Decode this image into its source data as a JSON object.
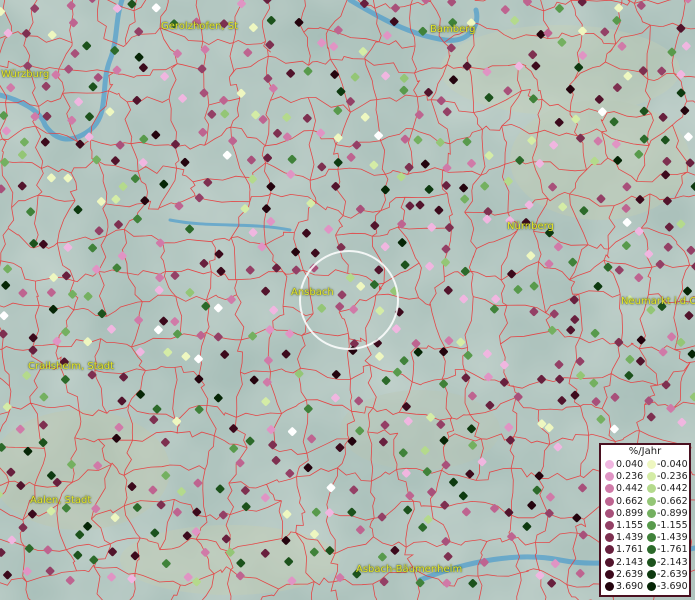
{
  "cities": [
    {
      "name": "Gerolzhofen, St",
      "key": "gerolzhofen"
    },
    {
      "name": "Bamberg",
      "key": "bamberg"
    },
    {
      "name": "Würzburg",
      "key": "wuerzburg"
    },
    {
      "name": "Nürnberg",
      "key": "nuernberg"
    },
    {
      "name": "Ansbach",
      "key": "ansbach"
    },
    {
      "name": "Neumarkt i.d.O",
      "key": "neumarkt"
    },
    {
      "name": "Crailsheim, Stadt",
      "key": "crailsheim"
    },
    {
      "name": "Aalen, Stadt",
      "key": "aalen"
    },
    {
      "name": "Asbach-Bäumenheim",
      "key": "asbach"
    }
  ],
  "legend": {
    "title": "%/Jahr",
    "positive": [
      {
        "value": "0.040",
        "color": "#f0b6e0"
      },
      {
        "value": "0.236",
        "color": "#e094c4"
      },
      {
        "value": "0.442",
        "color": "#d07aa8"
      },
      {
        "value": "0.662",
        "color": "#be6490"
      },
      {
        "value": "0.899",
        "color": "#a8507a"
      },
      {
        "value": "1.155",
        "color": "#944066"
      },
      {
        "value": "1.439",
        "color": "#7e3050"
      },
      {
        "value": "1.761",
        "color": "#68203e"
      },
      {
        "value": "2.143",
        "color": "#52142c"
      },
      {
        "value": "2.639",
        "color": "#3c0a1c"
      },
      {
        "value": "3.690",
        "color": "#24040e"
      }
    ],
    "negative": [
      {
        "value": "-0.040",
        "color": "#eef7c0"
      },
      {
        "value": "-0.236",
        "color": "#d4eca6"
      },
      {
        "value": "-0.442",
        "color": "#b4da8c"
      },
      {
        "value": "-0.662",
        "color": "#94c676"
      },
      {
        "value": "-0.899",
        "color": "#74b060"
      },
      {
        "value": "-1.155",
        "color": "#589a4c"
      },
      {
        "value": "-1.439",
        "color": "#40823a"
      },
      {
        "value": "-1.761",
        "color": "#2c6a2a"
      },
      {
        "value": "-2.143",
        "color": "#1c521c"
      },
      {
        "value": "-2.639",
        "color": "#0e3a10"
      },
      {
        "value": "-3.690",
        "color": "#062606"
      }
    ]
  },
  "colors": {
    "background": "#9fb8b3",
    "boundary": "#e8393a",
    "river": "#2e8fd0",
    "label": "#e6e62a",
    "marker_white": "#ffffff"
  }
}
